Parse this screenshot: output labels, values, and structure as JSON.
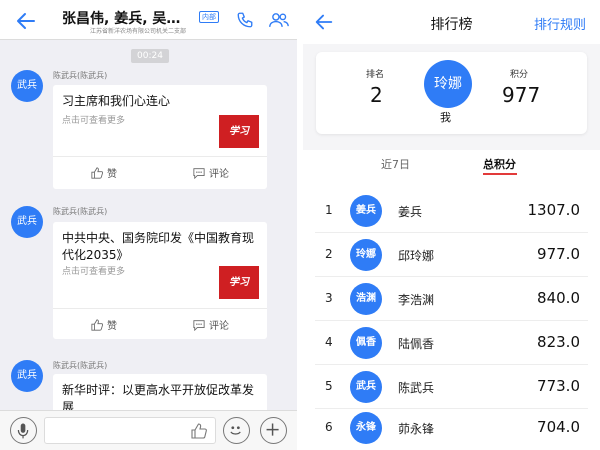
{
  "chat": {
    "header": {
      "title": "张昌伟, 姜兵, 吴…",
      "badge": "内部",
      "subtitle": "江苏省新洋农场有限公司机关二支部"
    },
    "time_label": "00:24",
    "messages": [
      {
        "avatar_label": "武兵",
        "sender": "陈武兵(陈武兵)",
        "title": "习主席和我们心连心",
        "more_text": "点击可查看更多",
        "logo_text": "学习",
        "like_label": "赞",
        "comment_label": "评论"
      },
      {
        "avatar_label": "武兵",
        "sender": "陈武兵(陈武兵)",
        "title": "中共中央、国务院印发《中国教育现代化2035》",
        "more_text": "点击可查看更多",
        "logo_text": "学习",
        "like_label": "赞",
        "comment_label": "评论"
      },
      {
        "avatar_label": "武兵",
        "sender": "陈武兵(陈武兵)",
        "title": "新华时评：以更高水平开放促改革发展"
      }
    ]
  },
  "leaderboard": {
    "header": {
      "title": "排行榜",
      "rules_label": "排行规则"
    },
    "summary": {
      "rank_label": "排名",
      "rank_value": "2",
      "avatar_label": "玲娜",
      "me_label": "我",
      "score_label": "积分",
      "score_value": "977"
    },
    "tabs": [
      {
        "label": "近7日"
      },
      {
        "label": "总积分"
      }
    ],
    "rows": [
      {
        "rank": "1",
        "avatar": "姜兵",
        "name": "姜兵",
        "score": "1307.0"
      },
      {
        "rank": "2",
        "avatar": "玲娜",
        "name": "邱玲娜",
        "score": "977.0"
      },
      {
        "rank": "3",
        "avatar": "浩渊",
        "name": "李浩渊",
        "score": "840.0"
      },
      {
        "rank": "4",
        "avatar": "佩香",
        "name": "陆佩香",
        "score": "823.0"
      },
      {
        "rank": "5",
        "avatar": "武兵",
        "name": "陈武兵",
        "score": "773.0"
      },
      {
        "rank": "6",
        "avatar": "永锋",
        "name": "茆永锋",
        "score": "704.0"
      }
    ]
  },
  "colors": {
    "accent": "#2f7cf6",
    "tab_underline": "#e23a3a",
    "logo_red": "#cf1f22"
  }
}
